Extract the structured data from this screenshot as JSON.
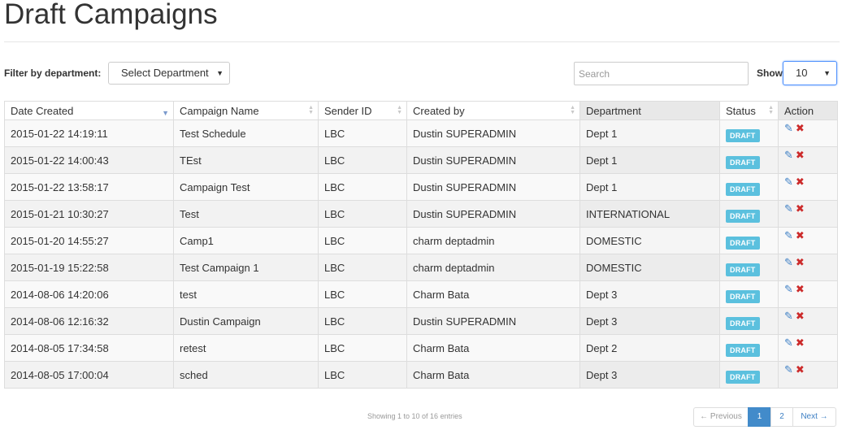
{
  "page": {
    "title": "Draft Campaigns"
  },
  "filter": {
    "label": "Filter by department:",
    "selected": "Select Department"
  },
  "search": {
    "placeholder": "Search",
    "value": ""
  },
  "length": {
    "label": "Show",
    "selected": "10"
  },
  "table": {
    "columns": [
      "Date Created",
      "Campaign Name",
      "Sender ID",
      "Created by",
      "Department",
      "Status",
      "Action"
    ],
    "rows": [
      [
        "2015-01-22 14:19:11",
        "Test Schedule",
        "LBC",
        "Dustin SUPERADMIN",
        "Dept 1",
        "DRAFT"
      ],
      [
        "2015-01-22 14:00:43",
        "TEst",
        "LBC",
        "Dustin SUPERADMIN",
        "Dept 1",
        "DRAFT"
      ],
      [
        "2015-01-22 13:58:17",
        "Campaign Test",
        "LBC",
        "Dustin SUPERADMIN",
        "Dept 1",
        "DRAFT"
      ],
      [
        "2015-01-21 10:30:27",
        "Test",
        "LBC",
        "Dustin SUPERADMIN",
        "INTERNATIONAL",
        "DRAFT"
      ],
      [
        "2015-01-20 14:55:27",
        "Camp1",
        "LBC",
        "charm deptadmin",
        "DOMESTIC",
        "DRAFT"
      ],
      [
        "2015-01-19 15:22:58",
        "Test Campaign 1",
        "LBC",
        "charm deptadmin",
        "DOMESTIC",
        "DRAFT"
      ],
      [
        "2014-08-06 14:20:06",
        "test",
        "LBC",
        "Charm Bata",
        "Dept 3",
        "DRAFT"
      ],
      [
        "2014-08-06 12:16:32",
        "Dustin Campaign",
        "LBC",
        "Dustin SUPERADMIN",
        "Dept 3",
        "DRAFT"
      ],
      [
        "2014-08-05 17:34:58",
        "retest",
        "LBC",
        "Charm Bata",
        "Dept 2",
        "DRAFT"
      ],
      [
        "2014-08-05 17:00:04",
        "sched",
        "LBC",
        "Charm Bata",
        "Dept 3",
        "DRAFT"
      ]
    ]
  },
  "footer": {
    "info": "Showing 1 to 10 of 16 entries",
    "pagination": {
      "prev": "← Previous",
      "pages": [
        "1",
        "2"
      ],
      "next": "Next →"
    }
  },
  "icons": {
    "edit": "edit-icon",
    "delete": "delete-icon",
    "sort": "sort-icon"
  },
  "colors": {
    "badge": "#5bc0de",
    "active_page": "#428bca",
    "delete": "#cc2b2b",
    "edit": "#3d7fc4"
  }
}
